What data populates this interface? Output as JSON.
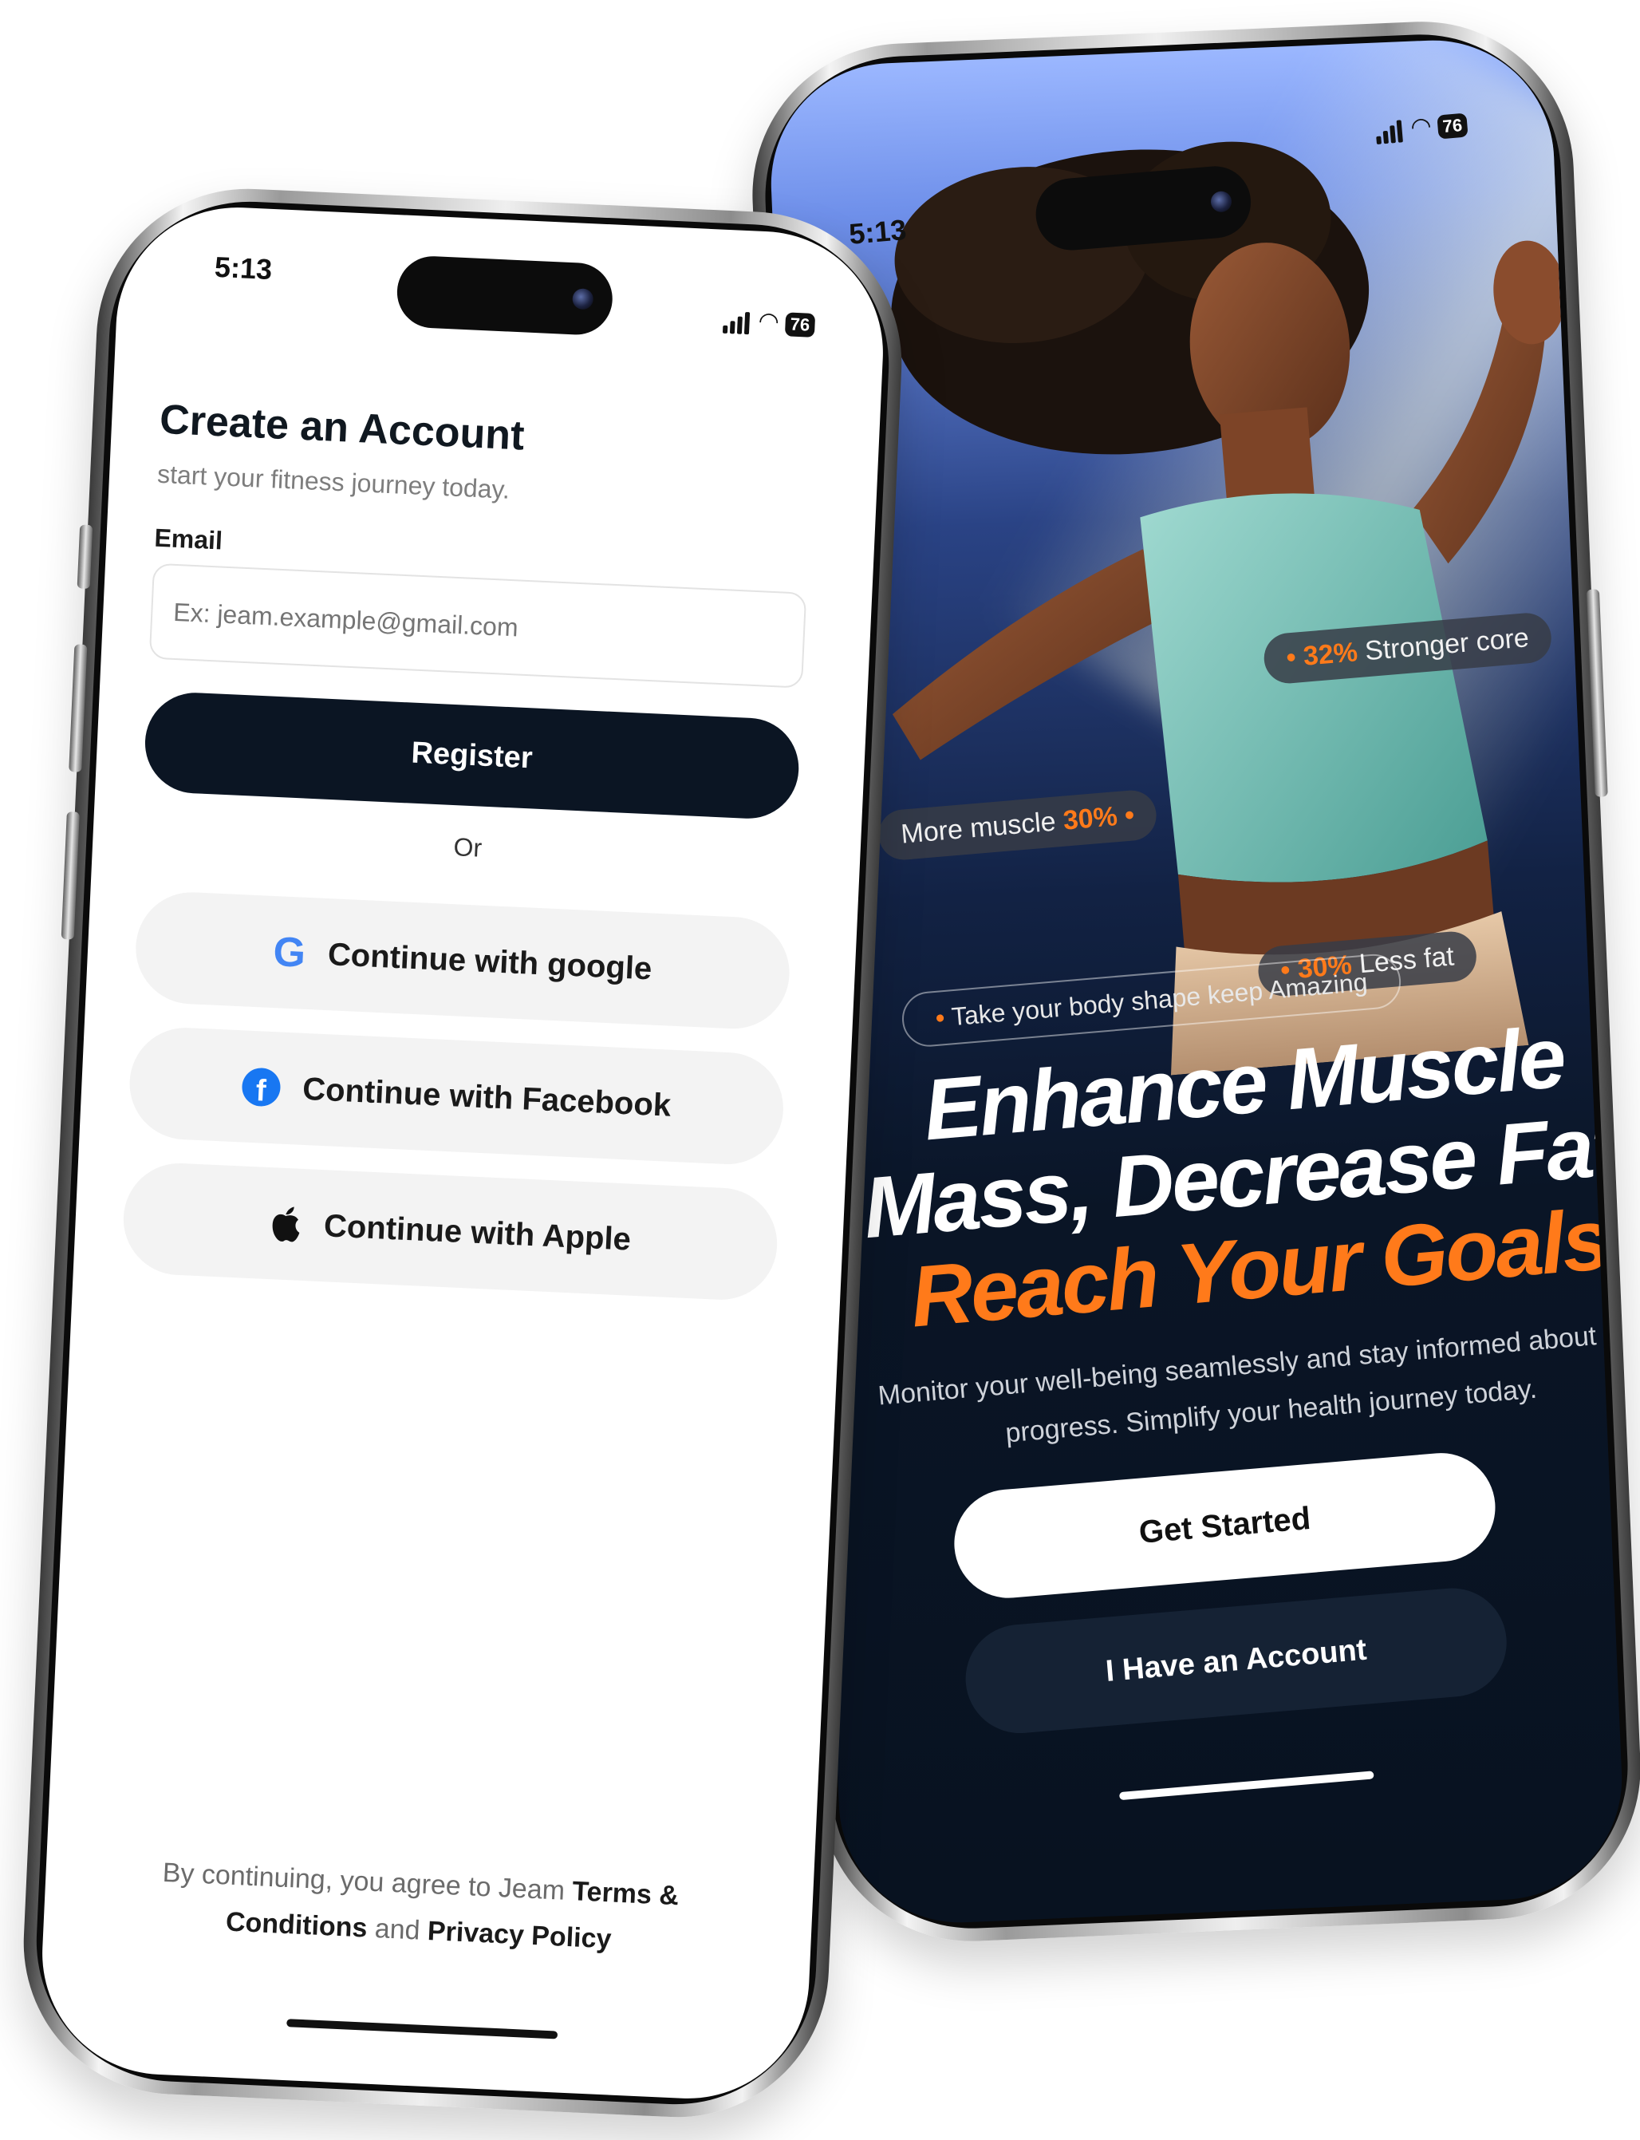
{
  "left_phone": {
    "status": {
      "time": "5:13",
      "battery": "76"
    },
    "title": "Create an Account",
    "subtitle": "start your fitness journey today.",
    "email": {
      "label": "Email",
      "placeholder": "Ex: jeam.example@gmail.com",
      "value": ""
    },
    "register_label": "Register",
    "divider": "Or",
    "social": [
      {
        "label": "Continue with google",
        "icon": "google-icon"
      },
      {
        "label": "Continue with Facebook",
        "icon": "facebook-icon"
      },
      {
        "label": "Continue with Apple",
        "icon": "apple-icon"
      }
    ],
    "terms": {
      "prefix": "By continuing, you agree to Jeam",
      "terms_link": "Terms & Conditions",
      "conjunction": "and",
      "privacy_link": "Privacy Policy"
    }
  },
  "right_phone": {
    "status": {
      "time": "5:13",
      "battery": "76"
    },
    "stats": [
      {
        "pct": "32%",
        "label": "Stronger core"
      },
      {
        "pct": "30%",
        "label": "More muscle"
      },
      {
        "pct": "30%",
        "label": "Less fat"
      }
    ],
    "tagline": "Take your body shape keep Amazing",
    "headline": {
      "line1": "Enhance Muscle",
      "line2": "Mass, Decrease Fat,",
      "line3": "Reach Your Goals"
    },
    "description": "Monitor your well-being seamlessly and stay informed about your progress. Simplify your health journey today.",
    "primary_button": "Get Started",
    "secondary_button": "I Have an Account"
  },
  "colors": {
    "accent": "#ff7a1a",
    "dark_button": "#0b1523",
    "social_bg": "#f3f3f3"
  }
}
